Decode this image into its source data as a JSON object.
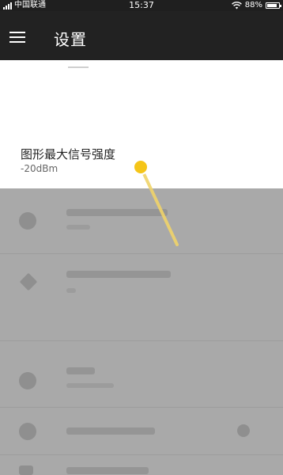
{
  "status_bar": {
    "carrier": "中国联通",
    "time": "15:37",
    "battery": "88%",
    "battery_level": 0.88,
    "icons": [
      "signal-icon",
      "wifi-icon",
      "battery-icon"
    ]
  },
  "app_bar": {
    "title": "设置",
    "menu_icon": "menu-icon"
  },
  "dialog": {
    "item_title": "图形最大信号强度",
    "item_value": "-20dBm"
  },
  "colors": {
    "app_bar": "#222222",
    "status_bar": "#1f1f1f",
    "dim_background": "#a9a9a9",
    "touch_point": "#f5c518"
  }
}
